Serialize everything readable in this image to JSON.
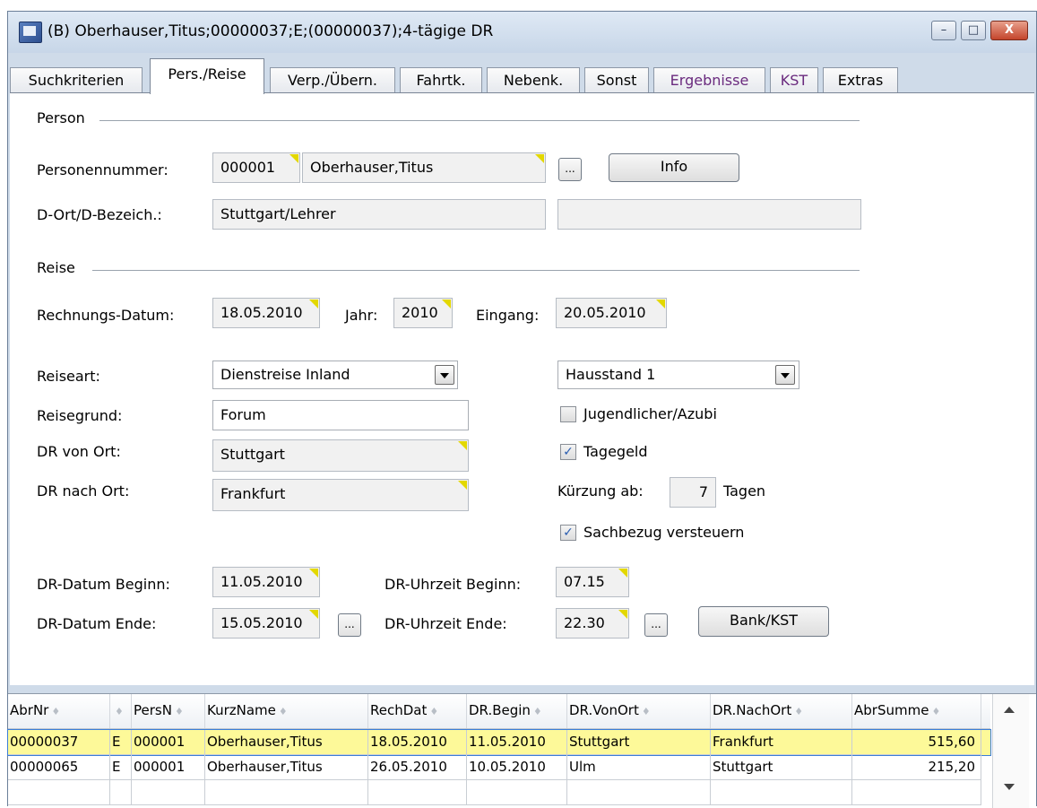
{
  "window": {
    "title": "(B) Oberhauser,Titus;00000037;E;(00000037);4-tägige DR",
    "minimize": "–",
    "maximize": "□",
    "close": "X"
  },
  "tabs": [
    {
      "label": "Suchkriterien"
    },
    {
      "label": "Pers./Reise"
    },
    {
      "label": "Verp./Übern."
    },
    {
      "label": "Fahrtk."
    },
    {
      "label": "Nebenk."
    },
    {
      "label": "Sonst"
    },
    {
      "label": "Ergebnisse"
    },
    {
      "label": "KST"
    },
    {
      "label": "Extras"
    }
  ],
  "person": {
    "section": "Person",
    "personennummer_label": "Personennummer:",
    "personennummer": "000001",
    "name": "Oberhauser,Titus",
    "browse_button": "...",
    "info_button": "Info",
    "dort_label": "D-Ort/D-Bezeich.:",
    "dort": "Stuttgart/Lehrer",
    "dbezeich": ""
  },
  "reise": {
    "section": "Reise",
    "rechnungsdatum_label": "Rechnungs-Datum:",
    "rechnungsdatum": "18.05.2010",
    "jahr_label": "Jahr:",
    "jahr": "2010",
    "eingang_label": "Eingang:",
    "eingang": "20.05.2010",
    "reiseart_label": "Reiseart:",
    "reiseart": "Dienstreise Inland",
    "hausstand": "Hausstand 1",
    "reisegrund_label": "Reisegrund:",
    "reisegrund": "Forum",
    "jugendlicher_label": "Jugendlicher/Azubi",
    "jugendlicher_checked": false,
    "von_ort_label": "DR von Ort:",
    "von_ort": "Stuttgart",
    "tagegeld_label": "Tagegeld",
    "tagegeld_checked": true,
    "nach_ort_label": "DR nach Ort:",
    "nach_ort": "Frankfurt",
    "kuerzung_label": "Kürzung ab:",
    "kuerzung_value": "7",
    "kuerzung_unit": "Tagen",
    "sachbezug_label": "Sachbezug versteuern",
    "sachbezug_checked": true,
    "datum_beginn_label": "DR-Datum Beginn:",
    "datum_beginn": "11.05.2010",
    "uhrzeit_beginn_label": "DR-Uhrzeit Beginn:",
    "uhrzeit_beginn": "07.15",
    "datum_ende_label": "DR-Datum Ende:",
    "datum_ende": "15.05.2010",
    "uhrzeit_ende_label": "DR-Uhrzeit Ende:",
    "uhrzeit_ende": "22.30",
    "browse_button": "...",
    "bank_button": "Bank/KST"
  },
  "grid": {
    "sort_icon": "♦",
    "columns": [
      "AbrNr",
      "",
      "PersN",
      "KurzName",
      "RechDat",
      "DR.Begin",
      "DR.VonOrt",
      "DR.NachOrt",
      "AbrSumme"
    ],
    "rows": [
      [
        "00000037",
        "E",
        "000001",
        "Oberhauser,Titus",
        "18.05.2010",
        "11.05.2010",
        "Stuttgart",
        "Frankfurt",
        "515,60"
      ],
      [
        "00000065",
        "E",
        "000001",
        "Oberhauser,Titus",
        "26.05.2010",
        "10.05.2010",
        "Ulm",
        "Stuttgart",
        "215,20"
      ]
    ]
  },
  "colors": {
    "selected_row": "#fdf999",
    "marker": "#e3d800",
    "purple_tab": "#6a2a7e"
  }
}
